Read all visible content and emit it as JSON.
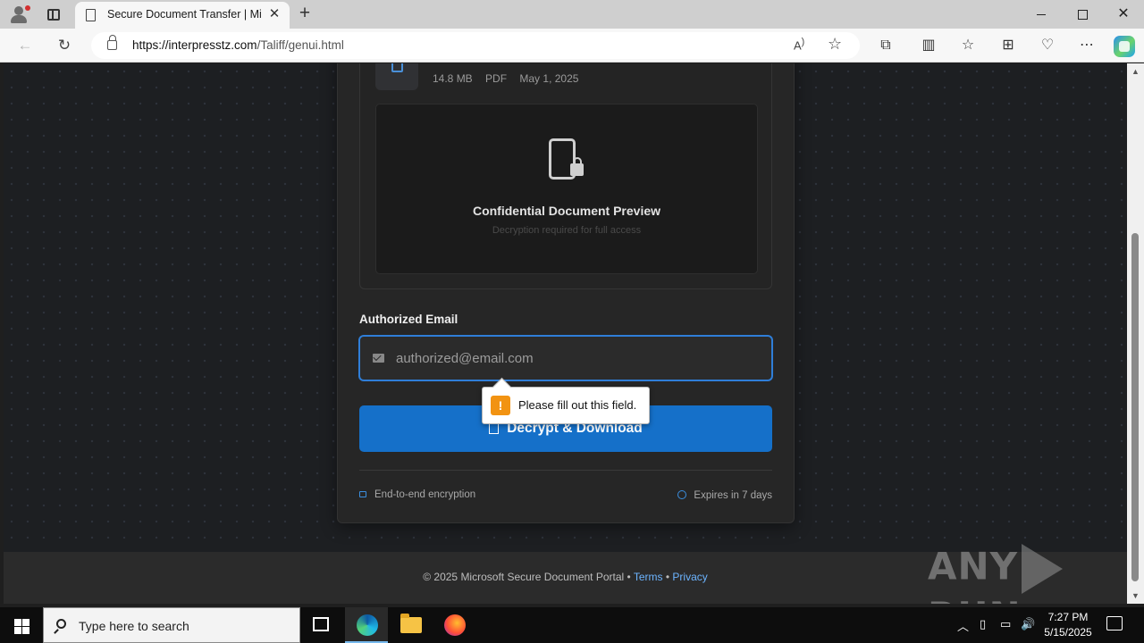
{
  "browser": {
    "tab_title": "Secure Document Transfer | Microsoft",
    "url_host": "https://interpresstz.com",
    "url_path": "/Taliff/genui.html"
  },
  "file": {
    "size": "14.8 MB",
    "type": "PDF",
    "date": "May 1, 2025",
    "icon": "document-icon"
  },
  "preview": {
    "title": "Confidential Document Preview",
    "subtitle": "Decryption required for full access",
    "icon": "locked-document-icon"
  },
  "form": {
    "email_label": "Authorized Email",
    "email_placeholder": "authorized@email.com",
    "email_value": "",
    "submit_label": "Decrypt & Download",
    "validation_message": "Please fill out this field."
  },
  "card_footer": {
    "left": "End-to-end encryption",
    "right": "Expires in 7 days"
  },
  "page_footer": {
    "copyright": "© 2025 Microsoft Secure Document Portal •",
    "terms": "Terms",
    "separator": "•",
    "privacy": "Privacy"
  },
  "watermark": "ANY RUN",
  "taskbar": {
    "search_placeholder": "Type here to search",
    "time": "7:27 PM",
    "date": "5/15/2025"
  },
  "colors": {
    "accent": "#1570c9",
    "page_bg": "#1d1f22",
    "card_bg": "#262626",
    "link": "#6cb4ff",
    "warning": "#f29312"
  }
}
